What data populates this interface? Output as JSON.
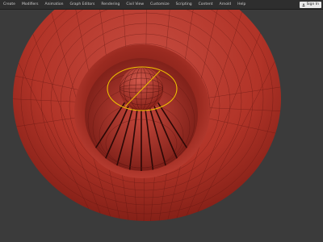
{
  "menu": {
    "items": [
      {
        "label": "Create"
      },
      {
        "label": "Modifiers"
      },
      {
        "label": "Animation"
      },
      {
        "label": "Graph Editors"
      },
      {
        "label": "Rendering"
      },
      {
        "label": "Civil View"
      },
      {
        "label": "Customize"
      },
      {
        "label": "Scripting"
      },
      {
        "label": "Content"
      },
      {
        "label": "Arnold"
      },
      {
        "label": "Help"
      }
    ],
    "signin_label": "Sign In"
  },
  "viewport": {
    "background_color": "#3b3b3b",
    "mesh_color": "#c0392b",
    "wire_color": "#5a1410",
    "gizmo_color": "#f0c200"
  }
}
